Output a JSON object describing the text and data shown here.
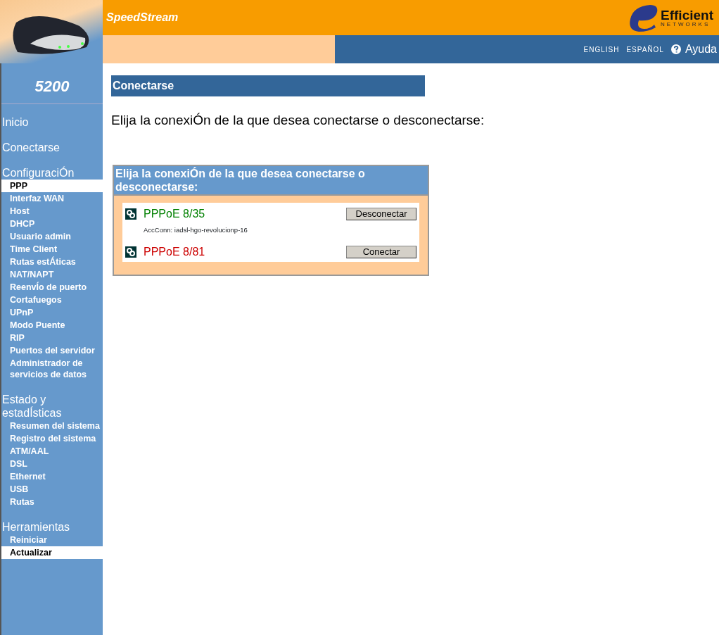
{
  "header": {
    "brand": "SpeedStream",
    "model": "5200",
    "company_logo": {
      "name": "Efficient",
      "subtitle": "NETWORKS"
    },
    "links": [
      {
        "label": "ENGLISH"
      },
      {
        "label": "ESPAÑOL"
      }
    ],
    "help": "Ayuda"
  },
  "sidebar": {
    "sections": [
      {
        "title": "Inicio"
      },
      {
        "title": "Conectarse"
      },
      {
        "title": "ConfiguraciÓn",
        "items": [
          {
            "label": "PPP",
            "selected": true
          },
          {
            "label": "Interfaz WAN",
            "selected": false
          },
          {
            "label": "Host",
            "selected": false
          },
          {
            "label": "DHCP",
            "selected": false
          },
          {
            "label": "Usuario admin",
            "selected": false
          },
          {
            "label": "Time Client",
            "selected": false
          },
          {
            "label": "Rutas estÁticas",
            "selected": false
          },
          {
            "label": "NAT/NAPT",
            "selected": false
          },
          {
            "label": "ReenvÍo de puerto",
            "selected": false
          },
          {
            "label": "Cortafuegos",
            "selected": false
          },
          {
            "label": "UPnP",
            "selected": false
          },
          {
            "label": "Modo Puente",
            "selected": false
          },
          {
            "label": "RIP",
            "selected": false
          },
          {
            "label": "Puertos del servidor",
            "selected": false
          },
          {
            "label": "Administrador de servicios de datos",
            "selected": false
          }
        ]
      },
      {
        "title": "Estado y estadÍsticas",
        "items": [
          {
            "label": "Resumen del sistema",
            "selected": false
          },
          {
            "label": "Registro del sistema",
            "selected": false
          },
          {
            "label": "ATM/AAL",
            "selected": false
          },
          {
            "label": "DSL",
            "selected": false
          },
          {
            "label": "Ethernet",
            "selected": false
          },
          {
            "label": "USB",
            "selected": false
          },
          {
            "label": "Rutas",
            "selected": false
          }
        ]
      },
      {
        "title": "Herramientas",
        "items": [
          {
            "label": "Reiniciar",
            "selected": false
          },
          {
            "label": "Actualizar",
            "selected": true
          }
        ]
      }
    ]
  },
  "main": {
    "title": "Conectarse",
    "intro": "Elija la conexiÓn de la que desea conectarse o desconectarse:",
    "panel": {
      "title": "Elija la conexiÓn de la que desea conectarse o desconectarse:",
      "connections": [
        {
          "name": "PPPoE 8/35",
          "color": "#008000",
          "detail": "AccConn: iadsl-hgo-revolucionp-16",
          "button": "Desconectar"
        },
        {
          "name": "PPPoE 8/81",
          "color": "#cc0000",
          "button": "Conectar"
        }
      ]
    }
  }
}
